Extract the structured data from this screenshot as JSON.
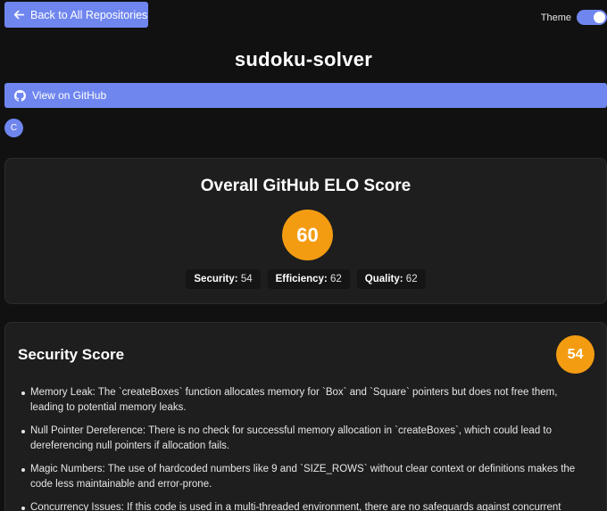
{
  "nav": {
    "back_label": "Back to All Repositories"
  },
  "theme": {
    "label": "Theme",
    "enabled": true
  },
  "repo": {
    "name": "sudoku-solver",
    "github_label": "View on GitHub",
    "language_chip": "C"
  },
  "elo": {
    "title": "Overall GitHub ELO Score",
    "score": "60",
    "metrics": [
      {
        "label": "Security:",
        "value": "54"
      },
      {
        "label": "Efficiency:",
        "value": "62"
      },
      {
        "label": "Quality:",
        "value": "62"
      }
    ]
  },
  "security": {
    "title": "Security Score",
    "score": "54",
    "issues": [
      "Memory Leak: The `createBoxes` function allocates memory for `Box` and `Square` pointers but does not free them, leading to potential memory leaks.",
      "Null Pointer Dereference: There is no check for successful memory allocation in `createBoxes`, which could lead to dereferencing null pointers if allocation fails.",
      "Magic Numbers: The use of hardcoded numbers like 9 and `SIZE_ROWS` without clear context or definitions makes the code less maintainable and error-prone.",
      "Concurrency Issues: If this code is used in a multi-threaded environment, there are no safeguards against concurrent"
    ]
  },
  "colors": {
    "accent": "#6f86ef",
    "score_badge": "#f39c12",
    "background": "#111111",
    "card": "#1e1e1e"
  }
}
